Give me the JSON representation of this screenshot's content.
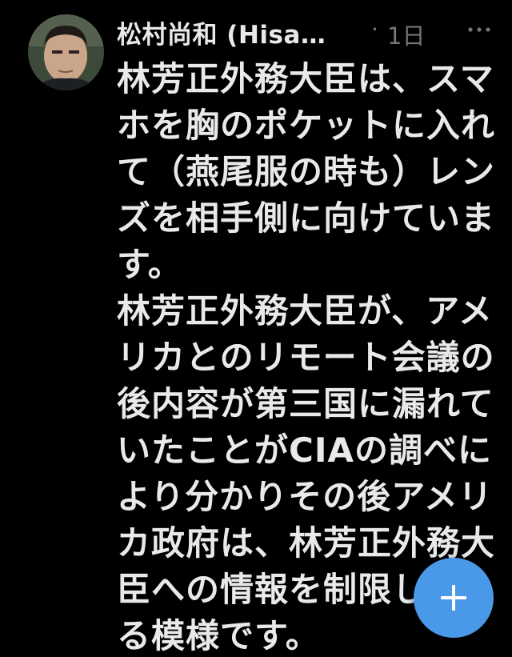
{
  "tweet": {
    "author": {
      "display_name": "松村尚和 (Hisa…",
      "avatar_icon": "person-photo-avatar"
    },
    "meta_separator": "·",
    "timestamp": "1日",
    "more_icon": "more-dots-icon",
    "text_lines": [
      "林芳正外務大臣は、スマ",
      "ホを胸のポケットに入れ",
      "て（燕尾服の時も）レン",
      "ズを相手側に向けていま",
      "す。",
      "林芳正外務大臣が、アメ",
      "リカとのリモート会議の",
      "後内容が第三国に漏れて",
      "いたことがCIAの調べに",
      "より分かりその後アメリ",
      "カ政府は、林芳正外務大",
      "臣への情報を制限してい",
      "る模様です。"
    ]
  },
  "compose_button": {
    "icon": "plus-icon",
    "color": "#4a99e9"
  },
  "colors": {
    "background": "#000000",
    "primary_text": "#e7e9ea",
    "secondary_text": "#71767b",
    "accent": "#4a99e9"
  }
}
